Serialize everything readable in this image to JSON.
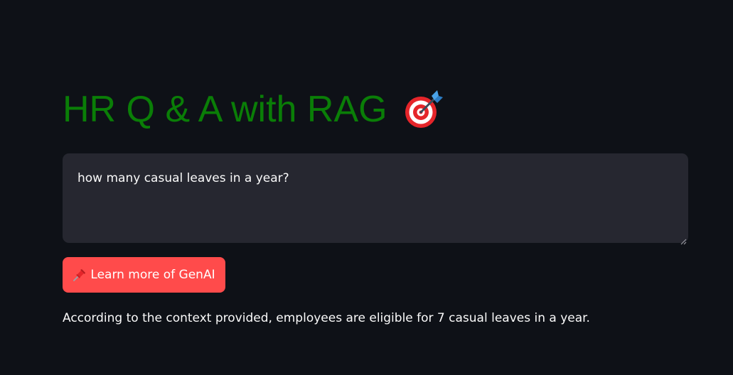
{
  "header": {
    "title": "HR Q & A with RAG",
    "title_icon": "target-dart-icon",
    "title_color": "#0a7e07"
  },
  "question_input": {
    "value": "how many casual leaves in a year?"
  },
  "action_button": {
    "icon": "pushpin-icon",
    "label": "Learn more of GenAI",
    "color": "#ff4b4b"
  },
  "response": {
    "text": "According to the context provided, employees are eligible for 7 casual leaves in a year."
  },
  "theme": {
    "background": "#0e1117",
    "input_background": "#262730",
    "text_color": "#fafafa"
  }
}
